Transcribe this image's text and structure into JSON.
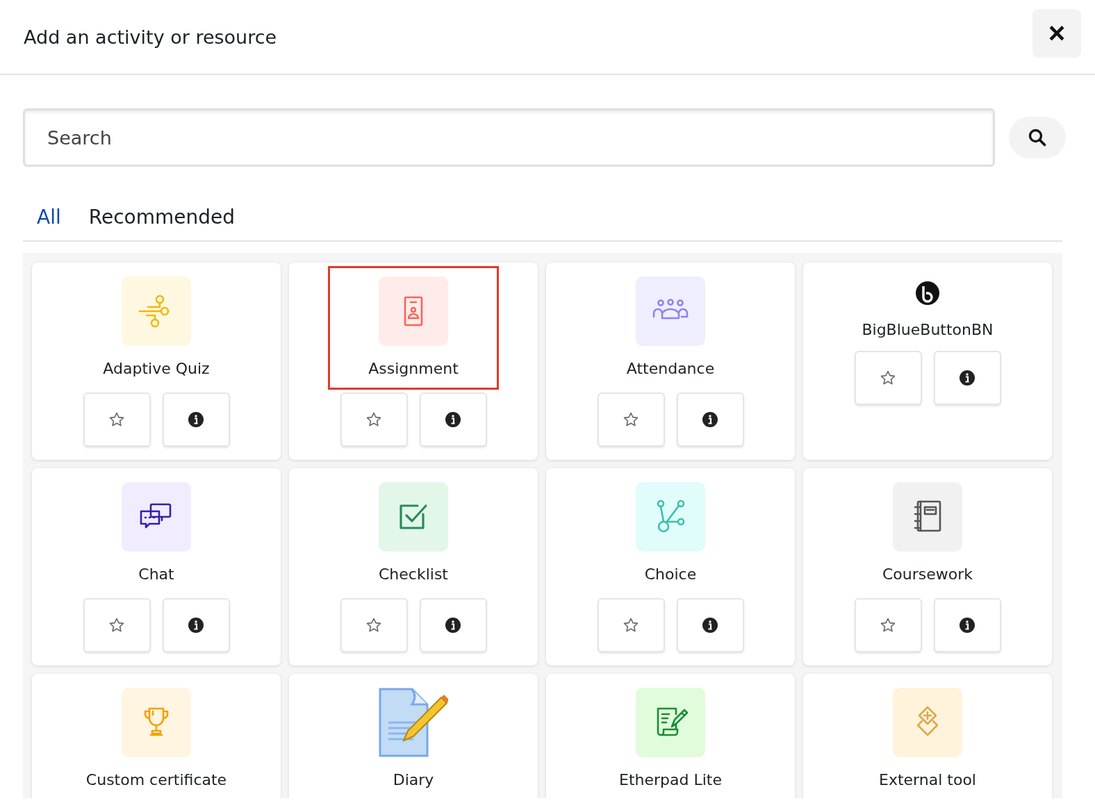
{
  "dialog": {
    "title": "Add an activity or resource",
    "close": "×"
  },
  "search": {
    "placeholder": "Search"
  },
  "tabs": [
    {
      "label": "All",
      "selected": true
    },
    {
      "label": "Recommended",
      "selected": false
    }
  ],
  "items": [
    {
      "name": "Adaptive Quiz",
      "kind": "tile",
      "color": "#fff8e1",
      "highlighted": false
    },
    {
      "name": "Assignment",
      "kind": "tile",
      "color": "#ffecea",
      "highlighted": true
    },
    {
      "name": "Attendance",
      "kind": "tile",
      "color": "#eeeeff",
      "highlighted": false
    },
    {
      "name": "BigBlueButtonBN",
      "kind": "logo",
      "highlighted": false
    },
    {
      "name": "Chat",
      "kind": "tile",
      "color": "#f1ecff",
      "highlighted": false
    },
    {
      "name": "Checklist",
      "kind": "tile",
      "color": "#e2f7ea",
      "highlighted": false
    },
    {
      "name": "Choice",
      "kind": "tile",
      "color": "#e0fcfb",
      "highlighted": false
    },
    {
      "name": "Coursework",
      "kind": "tile",
      "color": "#f1f1f1",
      "highlighted": false
    },
    {
      "name": "Custom certificate",
      "kind": "tile",
      "color": "#fff5e0",
      "highlighted": false
    },
    {
      "name": "Diary",
      "kind": "image",
      "highlighted": false
    },
    {
      "name": "Etherpad Lite",
      "kind": "tile",
      "color": "#e0fcda",
      "highlighted": false
    },
    {
      "name": "External tool",
      "kind": "tile",
      "color": "#fff3dc",
      "highlighted": false
    }
  ]
}
